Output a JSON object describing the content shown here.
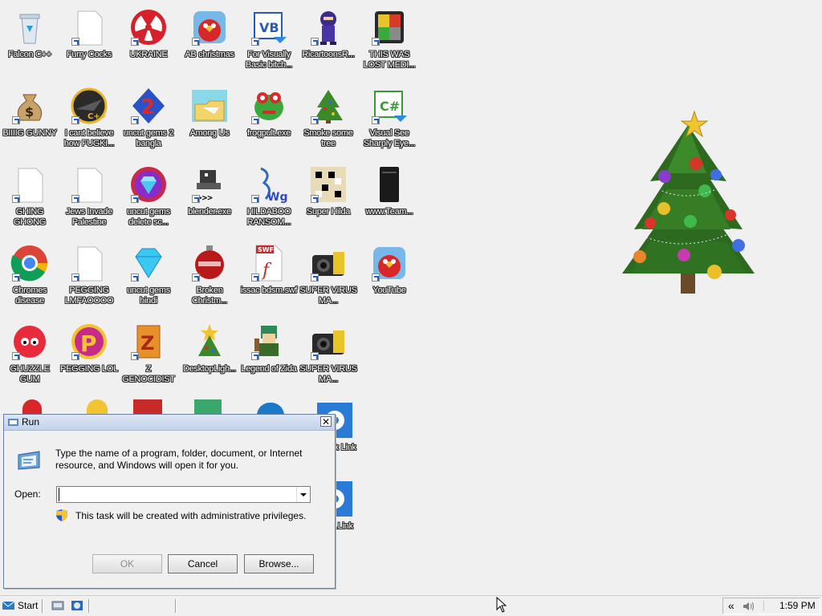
{
  "desktop_icons": [
    {
      "label": "Falcon C++",
      "icon": "recycle-bin-icon"
    },
    {
      "label": "Furry Cocks",
      "icon": "blank-file-icon"
    },
    {
      "label": "UKRAINE",
      "icon": "radiation-icon"
    },
    {
      "label": "AB christmas",
      "icon": "angry-bird-icon"
    },
    {
      "label": "For Visually Basic bitch...",
      "icon": "vb-icon"
    },
    {
      "label": "RicartoonsR...",
      "icon": "ninja-icon"
    },
    {
      "label": "THIS WAS LOST MEDI...",
      "icon": "lost-media-icon"
    },
    {
      "label": "BIIIIG GUNNY",
      "icon": "money-bag-icon"
    },
    {
      "label": "I cant believe how FUGKI...",
      "icon": "cpp-icon"
    },
    {
      "label": "uncut gems 2 bangla",
      "icon": "number-2-icon"
    },
    {
      "label": "Among Us",
      "icon": "folder-icon"
    },
    {
      "label": "frogpult.exe",
      "icon": "frog-icon"
    },
    {
      "label": "Smoke some tree",
      "icon": "tree-icon"
    },
    {
      "label": "Visual See Sharply Eye...",
      "icon": "csharp-icon"
    },
    {
      "label": "GHING GHONG",
      "icon": "blank-file-icon"
    },
    {
      "label": "Jews Invade Palestine",
      "icon": "blank-file-icon"
    },
    {
      "label": "uncut gems delete sc...",
      "icon": "gem-icon"
    },
    {
      "label": "blender.exe",
      "icon": "robot-icon"
    },
    {
      "label": "HILDABOO RANSOM...",
      "icon": "wg-icon"
    },
    {
      "label": "Super Hilda",
      "icon": "pixel-art-icon"
    },
    {
      "label": "www.Team...",
      "icon": "phone-icon"
    },
    {
      "label": "Chromes disease",
      "icon": "chrome-icon"
    },
    {
      "label": "PEGGING LMFAOOOO",
      "icon": "blank-file-icon"
    },
    {
      "label": "uncut gems hindi",
      "icon": "diamond-icon"
    },
    {
      "label": "Broken Christm...",
      "icon": "ornament-icon"
    },
    {
      "label": "issac bdsm.swf",
      "icon": "flash-icon"
    },
    {
      "label": "SUPER VIRUS MA...",
      "icon": "camera-bag-icon"
    },
    {
      "label": "YouTube",
      "icon": "angry-bird-icon"
    },
    {
      "label": "GHUZZLE GUM",
      "icon": "fuzzy-red-icon"
    },
    {
      "label": "PEGGING LOL",
      "icon": "p-logo-icon"
    },
    {
      "label": "Z GENOCIDIST",
      "icon": "z-block-icon"
    },
    {
      "label": "DesktopLigh...",
      "icon": "star-tree-icon"
    },
    {
      "label": "Legend of Zida",
      "icon": "zelda-icon"
    },
    {
      "label": "SUPER VIRUS MA...",
      "icon": "camera-bag-icon"
    },
    {
      "label": "OS ...k Link",
      "icon": "gear-icon"
    },
    {
      "label": "OS ...Link",
      "icon": "gear-icon"
    }
  ],
  "run_dialog": {
    "title": "Run",
    "close_glyph": "✕",
    "description": "Type the name of a program, folder, document, or Internet resource, and Windows will open it for you.",
    "open_label": "Open:",
    "open_value": "",
    "admin_note": "This task will be created with administrative privileges.",
    "ok_label": "OK",
    "cancel_label": "Cancel",
    "browse_label": "Browse..."
  },
  "taskbar": {
    "start_label": "Start",
    "clock": "1:59 PM",
    "tray_chevron": "«"
  }
}
